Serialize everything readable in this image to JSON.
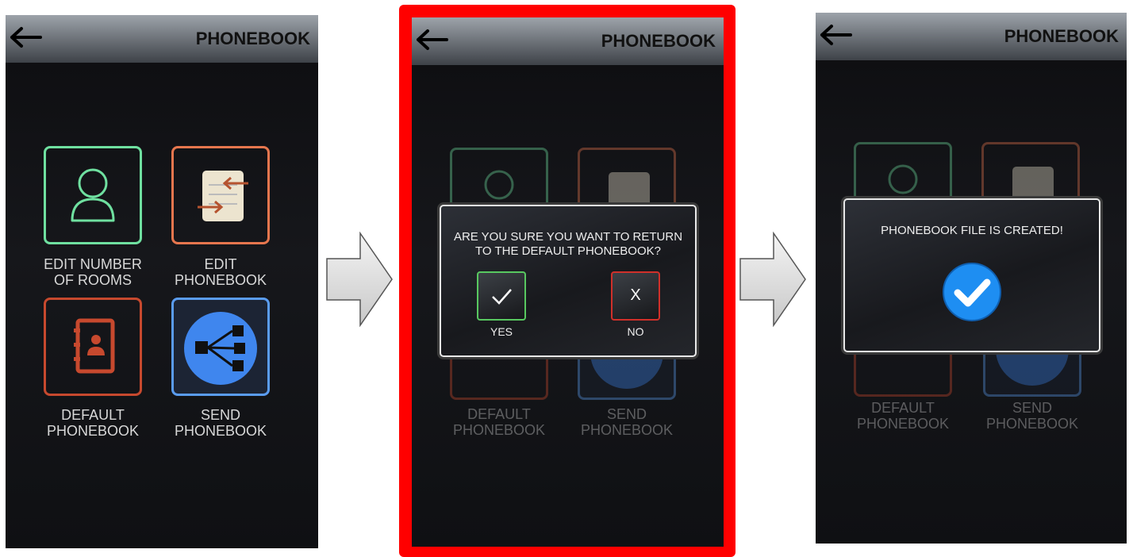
{
  "screens": [
    {
      "header": {
        "title": "PHONEBOOK",
        "back_icon": "arrow-left-icon"
      },
      "tiles": [
        {
          "icon": "user-icon",
          "label_1": "EDIT NUMBER",
          "label_2": "OF ROOMS"
        },
        {
          "icon": "document-arrows-icon",
          "label_1": "EDIT",
          "label_2": "PHONEBOOK"
        },
        {
          "icon": "contact-book-icon",
          "label_1": "DEFAULT",
          "label_2": "PHONEBOOK"
        },
        {
          "icon": "share-network-icon",
          "label_1": "SEND",
          "label_2": "PHONEBOOK"
        }
      ]
    },
    {
      "header": {
        "title": "PHONEBOOK",
        "back_icon": "arrow-left-icon"
      },
      "tiles": [
        {
          "label_1": "DEFAULT",
          "label_2": "PHONEBOOK"
        },
        {
          "label_1": "SEND",
          "label_2": "PHONEBOOK"
        }
      ],
      "dialog": {
        "line_1": "ARE YOU SURE YOU WANT TO RETURN",
        "line_2": "TO THE DEFAULT PHONEBOOK?",
        "yes_label": "YES",
        "no_label": "NO",
        "no_glyph": "X"
      }
    },
    {
      "header": {
        "title": "PHONEBOOK",
        "back_icon": "arrow-left-icon"
      },
      "tiles": [
        {
          "label_1": "DEFAULT",
          "label_2": "PHONEBOOK"
        },
        {
          "label_1": "SEND",
          "label_2": "PHONEBOOK"
        }
      ],
      "dialog": {
        "message": "PHONEBOOK FILE IS CREATED!",
        "icon": "check-circle-icon"
      }
    }
  ],
  "colors": {
    "highlight_frame": "#ff0000",
    "tile_green": "#6fe0a0",
    "tile_orange": "#e6764e",
    "tile_red": "#c7492e",
    "tile_blue": "#5a9cf0"
  },
  "flow_arrow_icon": "right-arrow-icon"
}
